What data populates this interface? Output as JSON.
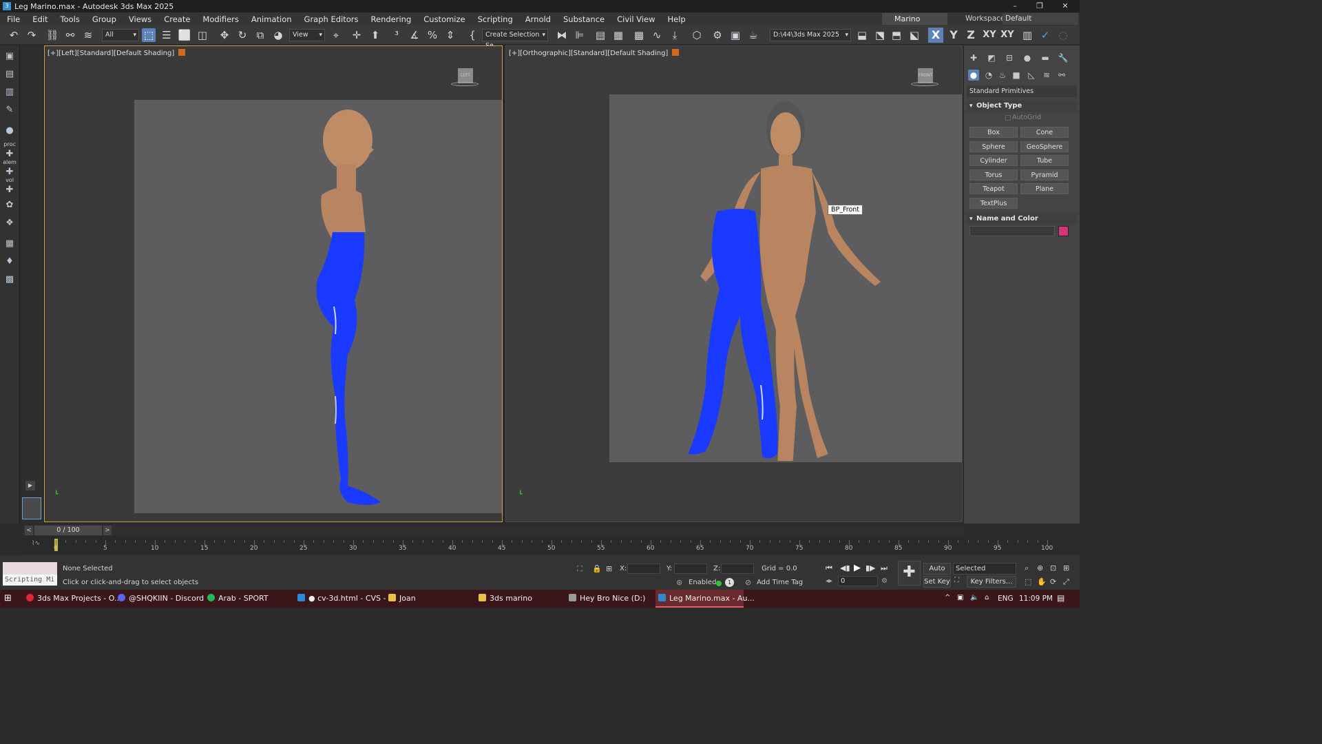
{
  "window": {
    "title": "Leg Marino.max - Autodesk 3ds Max 2025",
    "minimize": "–",
    "restore": "❐",
    "close": "✕"
  },
  "menu": [
    "File",
    "Edit",
    "Tools",
    "Group",
    "Views",
    "Create",
    "Modifiers",
    "Animation",
    "Graph Editors",
    "Rendering",
    "Customize",
    "Scripting",
    "Arnold",
    "Substance",
    "Civil View",
    "Help"
  ],
  "user": "Marino Cepele ▾",
  "workspace": {
    "label": "Workspaces:",
    "value": "Default"
  },
  "toolbar": {
    "filter": "All",
    "ref_coord": "View",
    "selection_set": "Create Selection Se",
    "project_path": "D:\\44\\3ds Max 2025",
    "axis_labels": [
      "X",
      "Y",
      "Z",
      "XY",
      "XY"
    ]
  },
  "left_tools": [
    "proc",
    "alem",
    "vol"
  ],
  "viewports": [
    {
      "label": "[+][Left][Standard][Default Shading]",
      "cube": "LEFT"
    },
    {
      "label": "[+][Orthographic][Standard][Default Shading]",
      "cube": "FRONT",
      "tooltip": "BP_Front"
    }
  ],
  "command_panel": {
    "category": "Standard Primitives",
    "object_type_title": "Object Type",
    "autogrid": "AutoGrid",
    "buttons": [
      "Box",
      "Cone",
      "Sphere",
      "GeoSphere",
      "Cylinder",
      "Tube",
      "Torus",
      "Pyramid",
      "Teapot",
      "Plane",
      "TextPlus"
    ],
    "name_color_title": "Name and Color",
    "object_color": "#d63577"
  },
  "time": {
    "position": "0 / 100",
    "ticks": [
      "0",
      "5",
      "10",
      "15",
      "20",
      "25",
      "30",
      "35",
      "40",
      "45",
      "50",
      "55",
      "60",
      "65",
      "70",
      "75",
      "80",
      "85",
      "90",
      "95",
      "100"
    ]
  },
  "status": {
    "script_box": "Scripting Mi",
    "selection": "None Selected",
    "prompt": "Click or click-and-drag to select objects",
    "x_label": "X:",
    "y_label": "Y:",
    "z_label": "Z:",
    "grid": "Grid = 0.0",
    "enabled": "Enabled:",
    "add_time_tag": "Add Time Tag",
    "auto_key": "Auto Key",
    "set_key": "Set Key",
    "key_mode": "Selected",
    "key_filters": "Key Filters...",
    "frame_value": "0"
  },
  "taskbar": {
    "items": [
      "3ds Max Projects - O...",
      "@SHQKIIN - Discord",
      "Arab - SPORT",
      "● cv-3d.html - CVS - ...",
      "Joan",
      "3ds marino",
      "Hey Bro Nice (D:)",
      "Leg Marino.max - Au..."
    ],
    "lang": "ENG",
    "time": "11:09 PM"
  }
}
